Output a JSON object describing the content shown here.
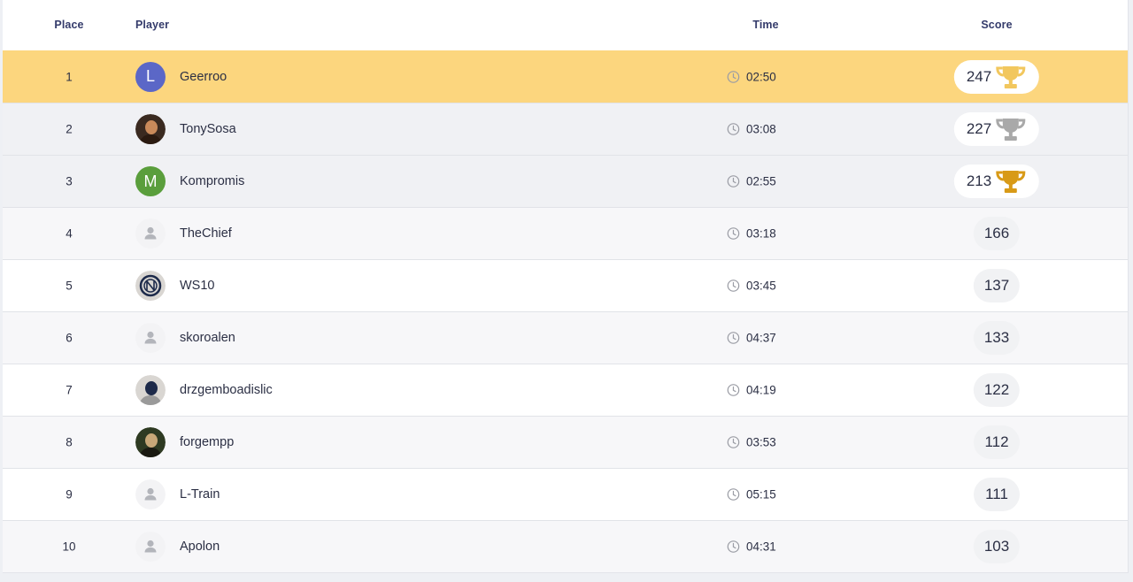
{
  "header": {
    "place": "Place",
    "player": "Player",
    "time": "Time",
    "score": "Score"
  },
  "colors": {
    "highlight_row": "#fcd67e",
    "alt_row": "#f5f5f7",
    "gold": "#f2c75e",
    "silver": "#a9a9a9",
    "bronze": "#d89a17",
    "clock": "#9a9ca4"
  },
  "rows": [
    {
      "place": "1",
      "name": "Geerroo",
      "time": "02:50",
      "score": "247",
      "avatar": "letter",
      "avatar_letter": "L",
      "avatar_color": "#5b67c7",
      "trophy": "gold-trophy-icon",
      "bg": "#fcd67e"
    },
    {
      "place": "2",
      "name": "TonySosa",
      "time": "03:08",
      "score": "227",
      "avatar": "photo",
      "avatar_icon": "user-photo-icon",
      "trophy": "silver-trophy-icon",
      "bg": "#f0f1f4"
    },
    {
      "place": "3",
      "name": "Kompromis",
      "time": "02:55",
      "score": "213",
      "avatar": "letter",
      "avatar_letter": "M",
      "avatar_color": "#5a9e3c",
      "trophy": "bronze-trophy-icon",
      "bg": "#f0f1f4"
    },
    {
      "place": "4",
      "name": "TheChief",
      "time": "03:18",
      "score": "166",
      "avatar": "default",
      "avatar_icon": "default-user-icon",
      "bg": "#f7f7f9"
    },
    {
      "place": "5",
      "name": "WS10",
      "time": "03:45",
      "score": "137",
      "avatar": "photo",
      "avatar_icon": "club-logo-icon",
      "bg": "#ffffff"
    },
    {
      "place": "6",
      "name": "skoroalen",
      "time": "04:37",
      "score": "133",
      "avatar": "default",
      "avatar_icon": "default-user-icon",
      "bg": "#f7f7f9"
    },
    {
      "place": "7",
      "name": "drzgemboadislic",
      "time": "04:19",
      "score": "122",
      "avatar": "photo",
      "avatar_icon": "user-photo-icon",
      "bg": "#ffffff"
    },
    {
      "place": "8",
      "name": "forgempp",
      "time": "03:53",
      "score": "112",
      "avatar": "photo",
      "avatar_icon": "user-photo-icon",
      "bg": "#f7f7f9"
    },
    {
      "place": "9",
      "name": "L-Train",
      "time": "05:15",
      "score": "111",
      "avatar": "default",
      "avatar_icon": "default-user-icon",
      "bg": "#ffffff"
    },
    {
      "place": "10",
      "name": "Apolon",
      "time": "04:31",
      "score": "103",
      "avatar": "default",
      "avatar_icon": "default-user-icon",
      "bg": "#f7f7f9"
    }
  ]
}
